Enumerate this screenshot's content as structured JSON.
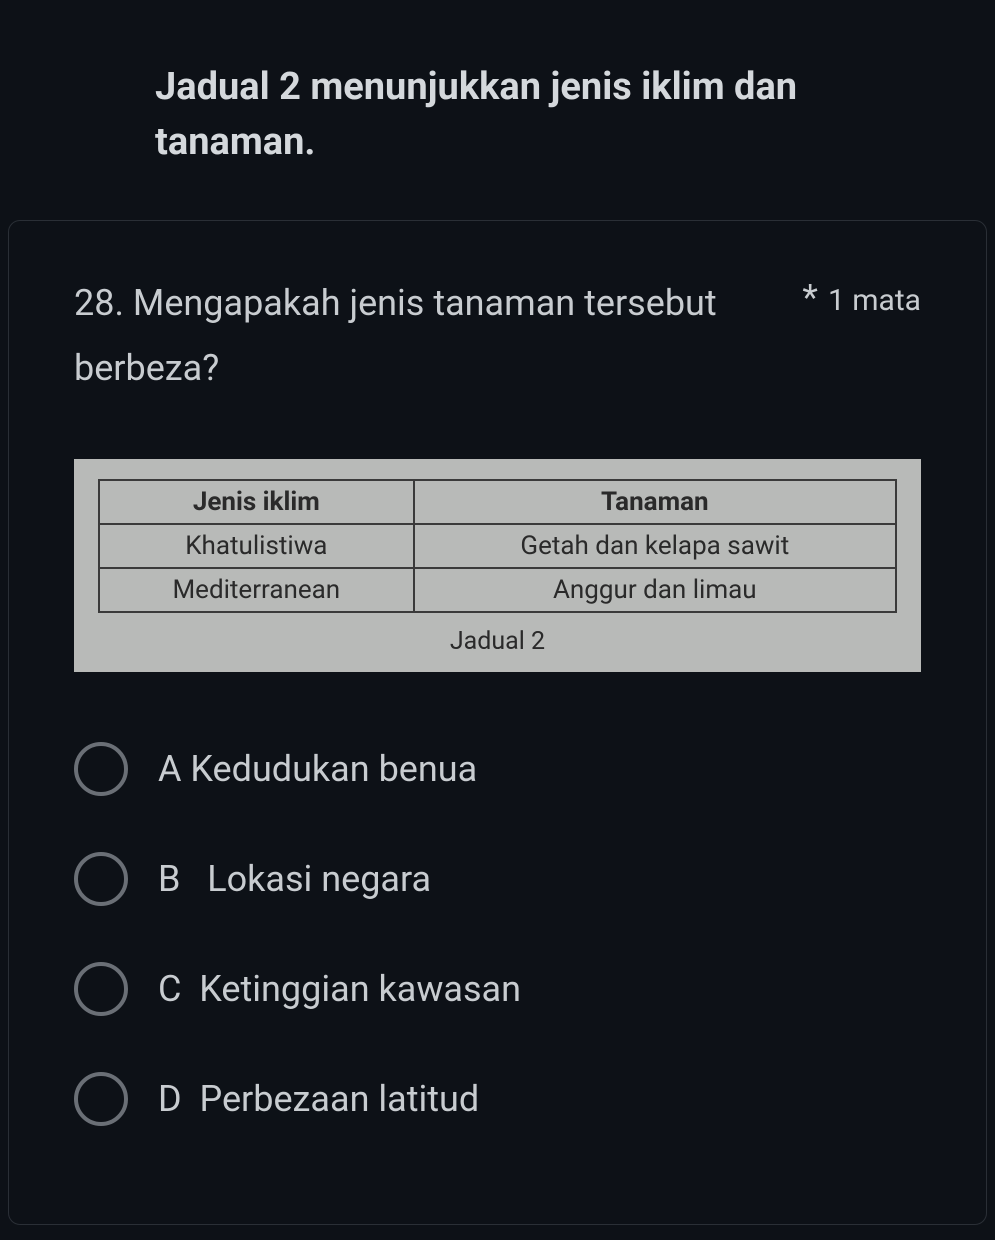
{
  "header": {
    "title": "Jadual 2 menunjukkan jenis iklim dan tanaman."
  },
  "question": {
    "text": "28. Mengapakah jenis tanaman tersebut berbeza?",
    "required_mark": "*",
    "points_label": "1 mata"
  },
  "table": {
    "headers": [
      "Jenis iklim",
      "Tanaman"
    ],
    "rows": [
      [
        "Khatulistiwa",
        "Getah dan kelapa sawit"
      ],
      [
        "Mediterranean",
        "Anggur dan limau"
      ]
    ],
    "caption": "Jadual 2"
  },
  "options": [
    {
      "label": "A Kedudukan benua"
    },
    {
      "label": "B   Lokasi negara"
    },
    {
      "label": "C  Ketinggian kawasan"
    },
    {
      "label": "D  Perbezaan latitud"
    }
  ]
}
